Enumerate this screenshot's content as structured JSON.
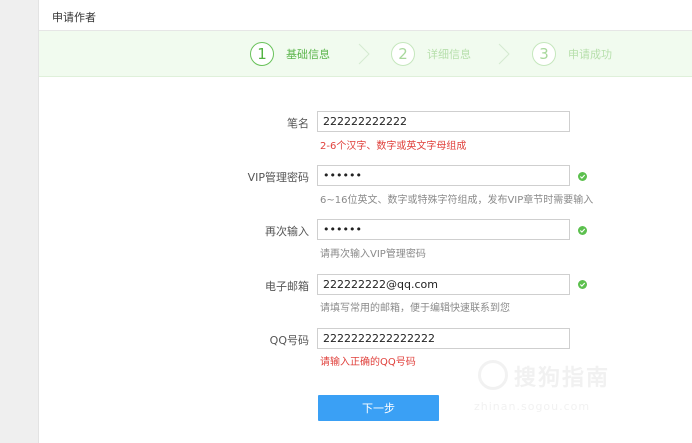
{
  "header": {
    "title": "申请作者"
  },
  "steps": [
    {
      "num": "1",
      "label": "基础信息"
    },
    {
      "num": "2",
      "label": "详细信息"
    },
    {
      "num": "3",
      "label": "申请成功"
    }
  ],
  "form": {
    "penname": {
      "label": "笔名",
      "value": "222222222222",
      "hint": "2-6个汉字、数字或英文字母组成"
    },
    "vip_password": {
      "label": "VIP管理密码",
      "value": "••••••",
      "hint": "6~16位英文、数字或特殊字符组成，发布VIP章节时需要输入"
    },
    "confirm": {
      "label": "再次输入",
      "value": "••••••",
      "hint": "请再次输入VIP管理密码"
    },
    "email": {
      "label": "电子邮箱",
      "value": "222222222@qq.com",
      "hint": "请填写常用的邮箱，便于编辑快速联系到您"
    },
    "qq": {
      "label": "QQ号码",
      "value": "2222222222222222",
      "hint": "请输入正确的QQ号码"
    }
  },
  "next_button": "下一步",
  "watermark": {
    "main": "搜狗指南",
    "sub": "zhinan.sogou.com"
  },
  "colors": {
    "accent": "#3aa0f5",
    "success": "#5cc04e",
    "error": "#e0413c",
    "step_active": "#52b341"
  },
  "icons": {
    "valid": "check-circle-icon"
  }
}
